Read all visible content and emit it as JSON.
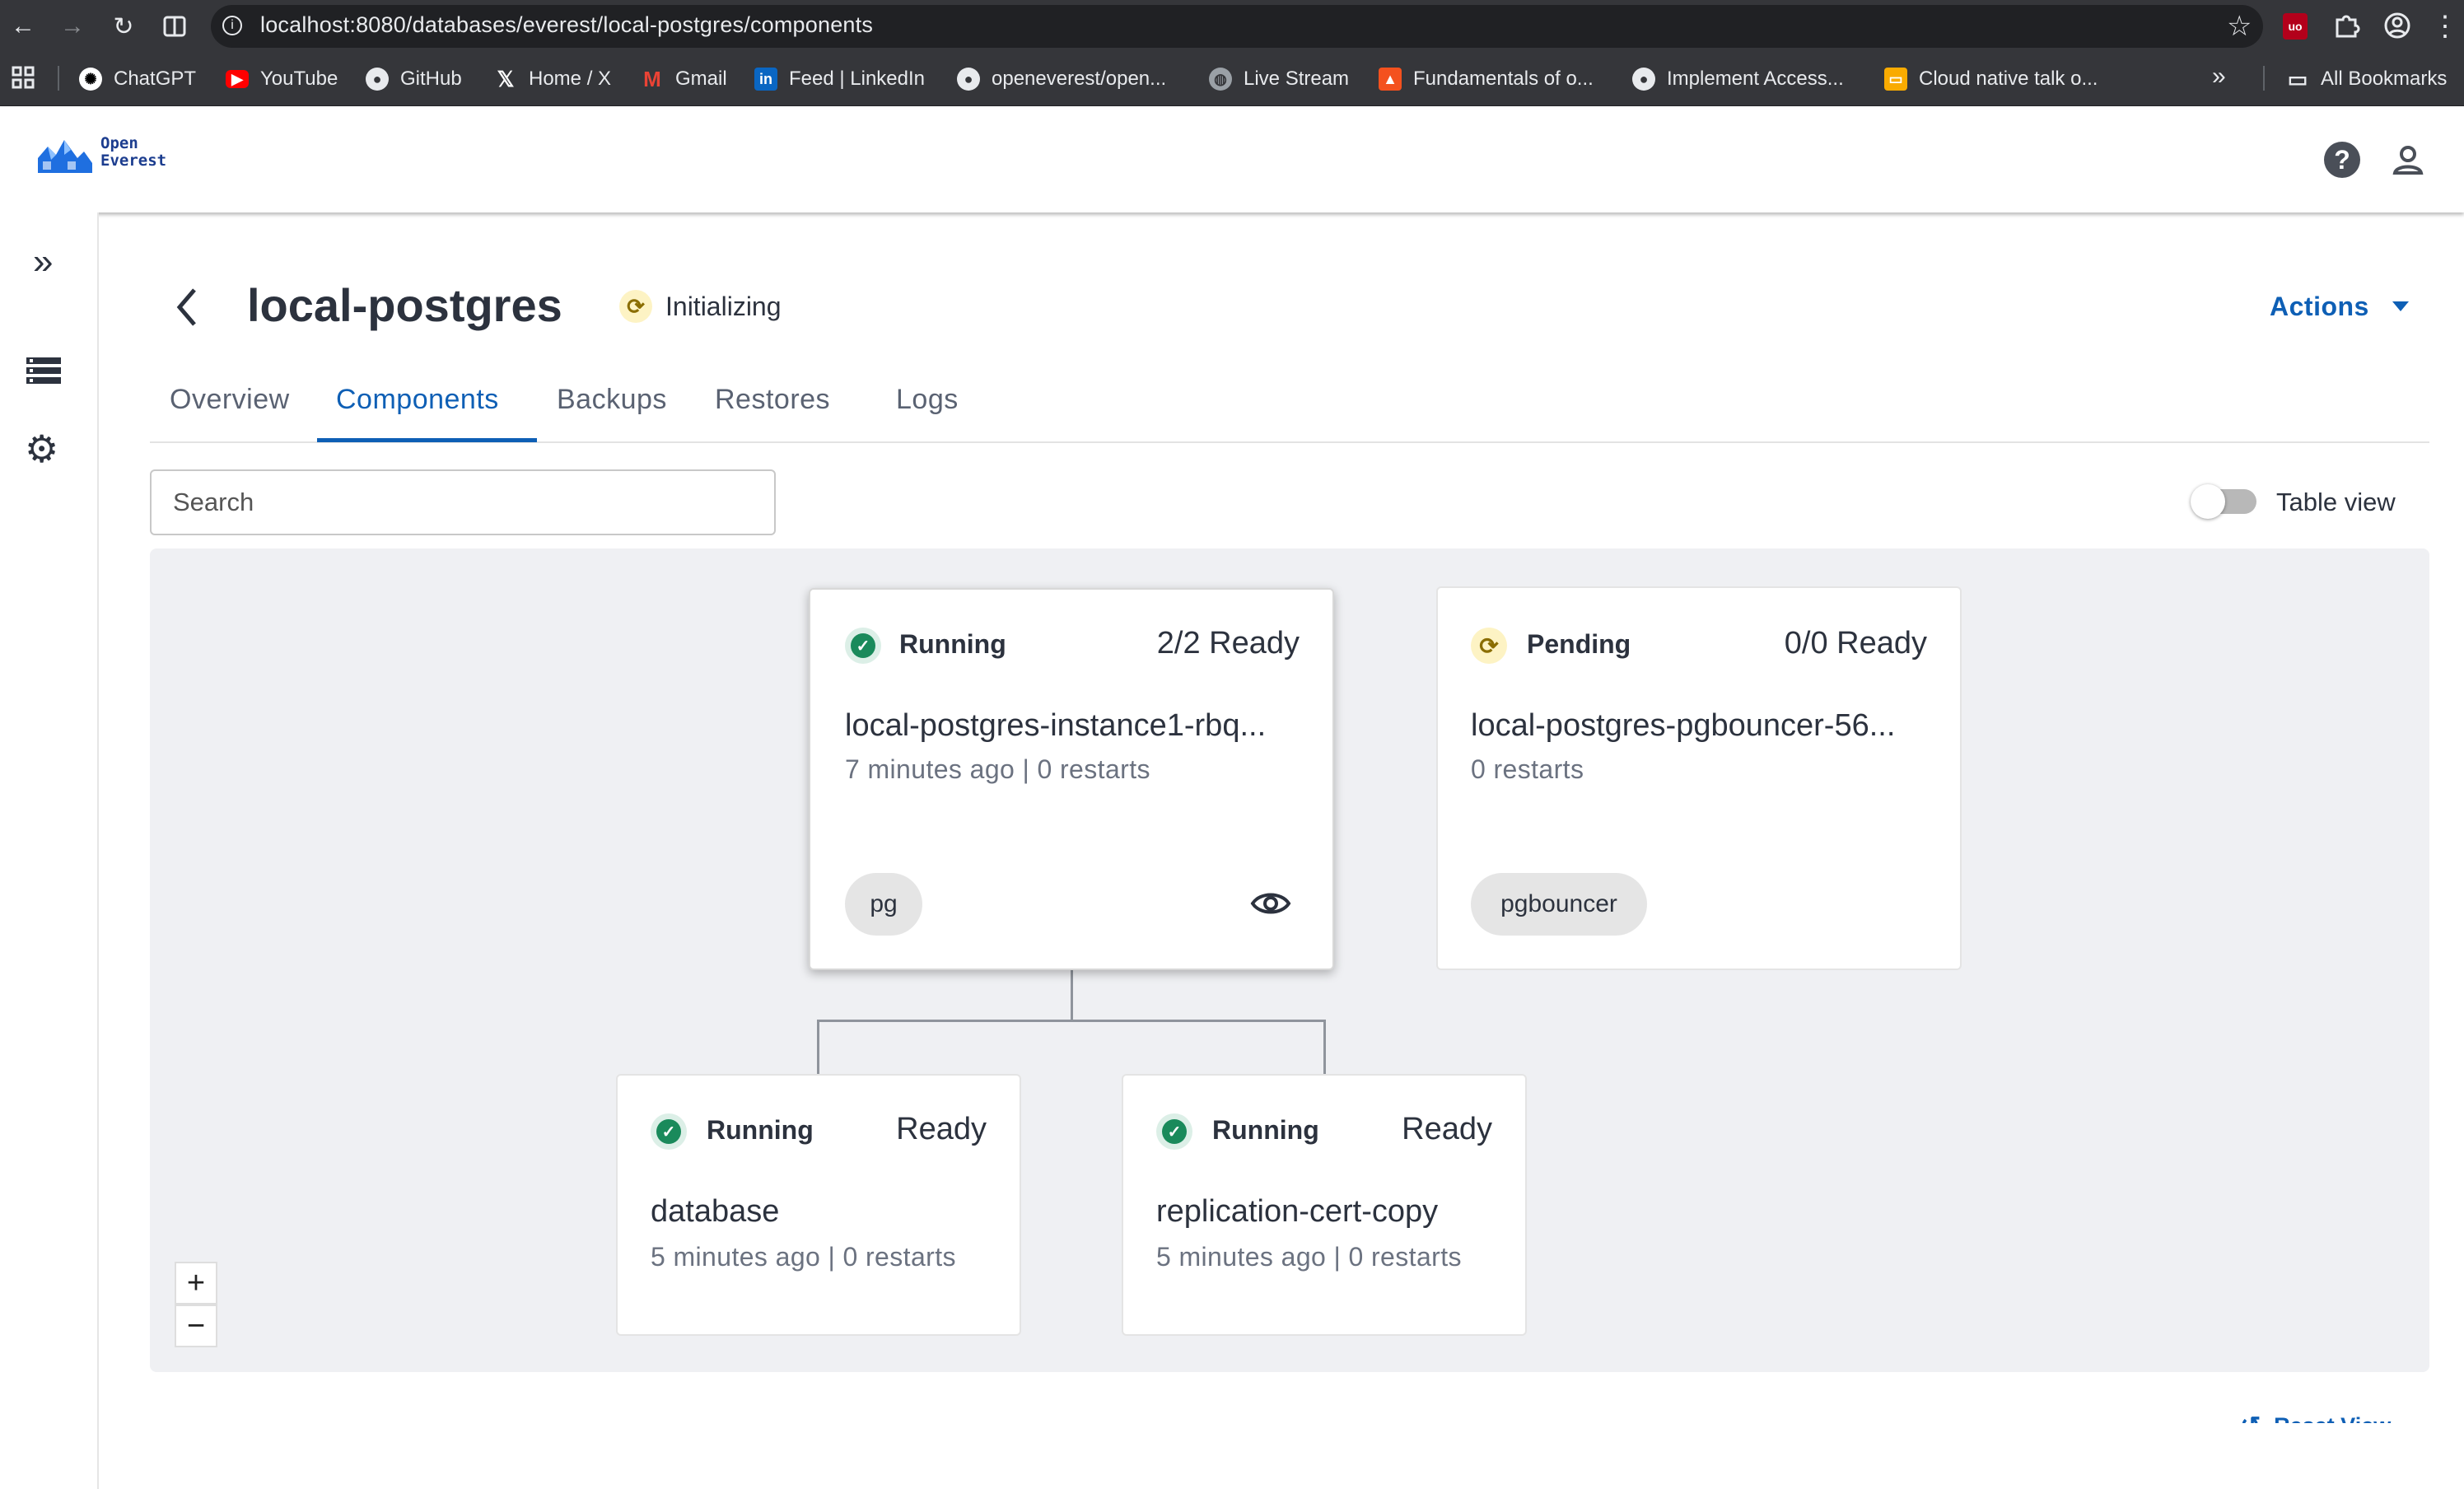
{
  "browser": {
    "url": "localhost:8080/databases/everest/local-postgres/components",
    "bookmarks": [
      {
        "label": "ChatGPT",
        "icon": "chatgpt-icon"
      },
      {
        "label": "YouTube",
        "icon": "youtube-icon"
      },
      {
        "label": "GitHub",
        "icon": "github-icon"
      },
      {
        "label": "Home / X",
        "icon": "x-icon"
      },
      {
        "label": "Gmail",
        "icon": "gmail-icon"
      },
      {
        "label": "Feed | LinkedIn",
        "icon": "linkedin-icon"
      },
      {
        "label": "openeverest/open...",
        "icon": "github-icon"
      },
      {
        "label": "Live Stream",
        "icon": "globe-icon"
      },
      {
        "label": "Fundamentals of o...",
        "icon": "fire-icon"
      },
      {
        "label": "Implement Access...",
        "icon": "github-icon"
      },
      {
        "label": "Cloud native talk o...",
        "icon": "slides-icon"
      }
    ],
    "all_bookmarks": "All Bookmarks"
  },
  "brand": {
    "line1": "Open",
    "line2": "Everest"
  },
  "page": {
    "title": "local-postgres",
    "status": "Initializing",
    "actions": "Actions"
  },
  "tabs": [
    "Overview",
    "Components",
    "Backups",
    "Restores",
    "Logs"
  ],
  "search": {
    "placeholder": "Search"
  },
  "table_view": {
    "label": "Table view",
    "enabled": false
  },
  "components": [
    {
      "status": "Running",
      "ready": "2/2 Ready",
      "name": "local-postgres-instance1-rbq...",
      "meta": "7 minutes ago | 0 restarts",
      "chip": "pg"
    },
    {
      "status": "Pending",
      "ready": "0/0 Ready",
      "name": "local-postgres-pgbouncer-56...",
      "meta": "0 restarts",
      "chip": "pgbouncer"
    },
    {
      "status": "Running",
      "ready": "Ready",
      "name": "database",
      "meta": "5 minutes ago | 0 restarts"
    },
    {
      "status": "Running",
      "ready": "Ready",
      "name": "replication-cert-copy",
      "meta": "5 minutes ago | 0 restarts"
    }
  ],
  "zoom": {
    "in": "+",
    "out": "−"
  },
  "reset_view": "Reset View",
  "colors": {
    "accent": "#0e5fb5",
    "running": "#1a8a5b",
    "pending": "#f5d33b",
    "canvas": "#eff0f3"
  }
}
